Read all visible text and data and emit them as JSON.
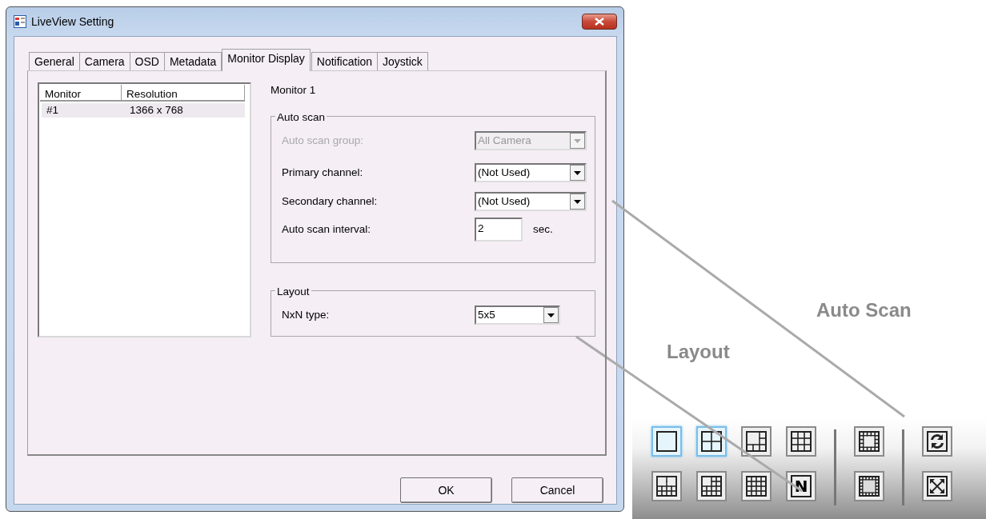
{
  "window": {
    "title": "LiveView Setting"
  },
  "tabs": [
    {
      "label": "General",
      "selected": false
    },
    {
      "label": "Camera",
      "selected": false
    },
    {
      "label": "OSD",
      "selected": false
    },
    {
      "label": "Metadata",
      "selected": false
    },
    {
      "label": "Monitor Display",
      "selected": true
    },
    {
      "label": "Notification",
      "selected": false
    },
    {
      "label": "Joystick",
      "selected": false
    }
  ],
  "monitor_list": {
    "columns": [
      "Monitor",
      "Resolution"
    ],
    "rows": [
      {
        "cells": [
          "#1",
          "1366 x 768"
        ],
        "selected": true
      }
    ]
  },
  "panel_title": "Monitor 1",
  "auto_scan": {
    "legend": "Auto scan",
    "fields": [
      {
        "kind": "combo",
        "label": "Auto scan group:",
        "value": "All Camera",
        "disabled": true
      },
      {
        "kind": "combo",
        "label": "Primary channel:",
        "value": "(Not Used)",
        "disabled": false
      },
      {
        "kind": "combo",
        "label": "Secondary channel:",
        "value": "(Not Used)",
        "disabled": false
      },
      {
        "kind": "number",
        "label": "Auto scan interval:",
        "value": "2",
        "unit": "sec.",
        "disabled": false
      }
    ]
  },
  "layout": {
    "legend": "Layout",
    "fields": [
      {
        "kind": "combo",
        "label": "NxN type:",
        "value": "5x5",
        "disabled": false
      }
    ]
  },
  "buttons": [
    "OK",
    "Cancel"
  ],
  "callouts": [
    {
      "label": "Auto Scan"
    },
    {
      "label": "Layout"
    }
  ],
  "toolbar": {
    "groups": [
      {
        "buttons": [
          {
            "kind": "grid1",
            "selected": true
          },
          {
            "kind": "grid4",
            "selected": true
          },
          {
            "kind": "grid6",
            "selected": false
          },
          {
            "kind": "grid9",
            "selected": false
          },
          {
            "kind": "grid10",
            "selected": false
          },
          {
            "kind": "grid13",
            "selected": false
          },
          {
            "kind": "grid16",
            "selected": false
          },
          {
            "kind": "custom",
            "label": "N",
            "selected": false
          }
        ]
      },
      {
        "buttons": [
          {
            "kind": "ring",
            "selected": false
          },
          {
            "kind": "ring2",
            "selected": false
          }
        ]
      },
      {
        "buttons": [
          {
            "kind": "sync",
            "selected": false
          },
          {
            "kind": "expand",
            "selected": false
          }
        ]
      }
    ]
  }
}
